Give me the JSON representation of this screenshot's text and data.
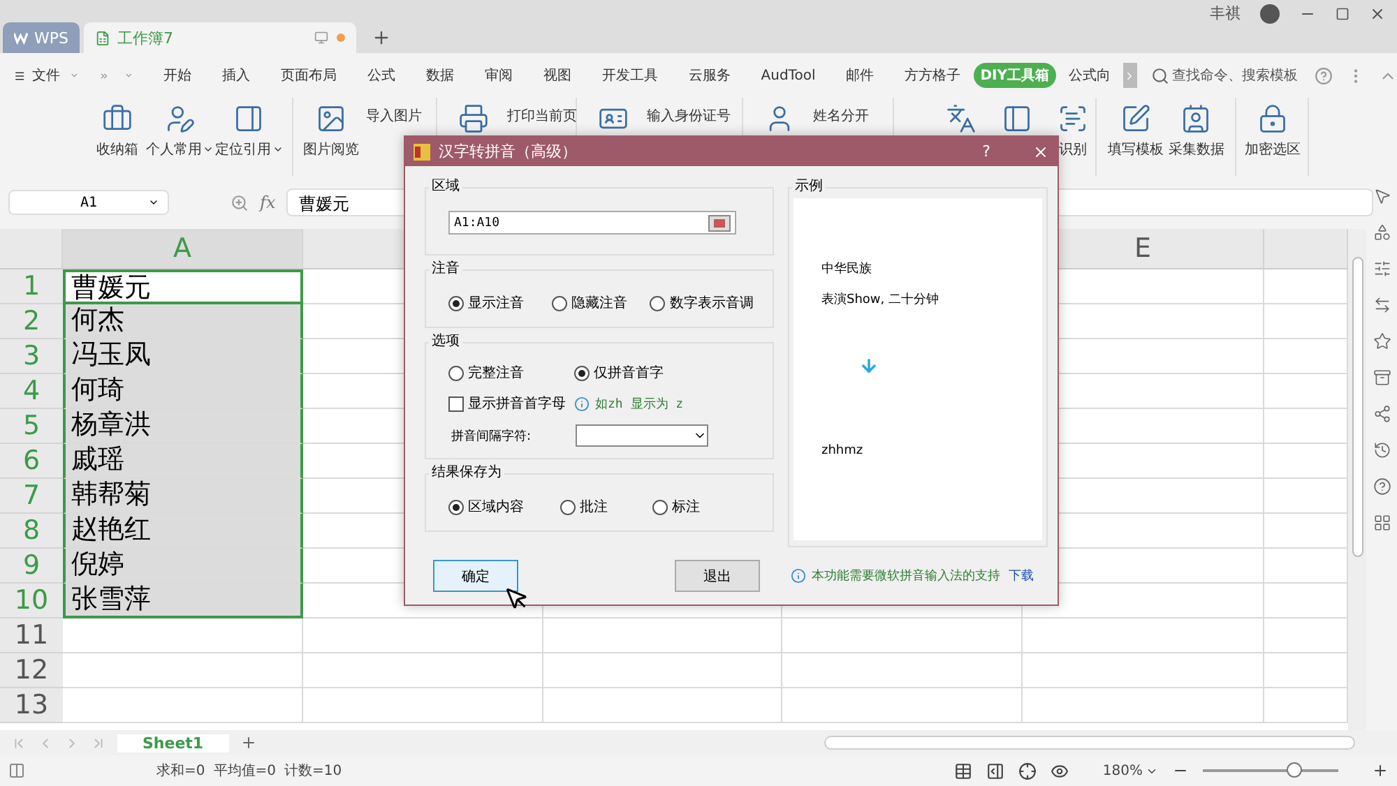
{
  "window": {
    "tabs": [
      {
        "label": "WPS",
        "selected": false
      },
      {
        "label": "工作簿7",
        "selected": true,
        "unsaved": true
      }
    ],
    "user": "丰祺"
  },
  "menu": {
    "file": "文件",
    "items": [
      {
        "label": "开始",
        "selected": false
      },
      {
        "label": "插入",
        "selected": false
      },
      {
        "label": "页面布局",
        "selected": false
      },
      {
        "label": "公式",
        "selected": false
      },
      {
        "label": "数据",
        "selected": false
      },
      {
        "label": "审阅",
        "selected": false
      },
      {
        "label": "视图",
        "selected": false
      },
      {
        "label": "开发工具",
        "selected": false
      },
      {
        "label": "云服务",
        "selected": false
      },
      {
        "label": "AudTool",
        "selected": false
      },
      {
        "label": "邮件",
        "selected": false
      },
      {
        "label": "方方格子",
        "selected": false
      },
      {
        "label": "DIY工具箱",
        "selected": true
      },
      {
        "label": "公式向",
        "selected": false
      }
    ],
    "search": {
      "placeholder": "查找命令、搜索模板"
    }
  },
  "ribbon": {
    "groups": [
      {
        "items": [
          {
            "kind": "big",
            "label": "收纳箱"
          },
          {
            "kind": "big",
            "label": "个人常用",
            "dropdown": true
          },
          {
            "kind": "big",
            "label": "定位引用",
            "dropdown": true
          }
        ]
      },
      {
        "items": [
          {
            "kind": "big",
            "label": "图片阅览"
          },
          {
            "kind": "small",
            "lines": [
              "导入图片"
            ]
          }
        ]
      },
      {
        "items": [
          {
            "kind": "big"
          },
          {
            "kind": "small",
            "lines": [
              "打印当前页"
            ]
          }
        ]
      },
      {
        "items": [
          {
            "kind": "big"
          },
          {
            "kind": "small",
            "lines": [
              "输入身份证号"
            ]
          }
        ]
      },
      {
        "items": [
          {
            "kind": "big"
          },
          {
            "kind": "small",
            "lines": [
              "姓名分开"
            ]
          }
        ]
      },
      {
        "items": [
          {
            "kind": "big"
          },
          {
            "kind": "big"
          },
          {
            "kind": "big",
            "label": "识别"
          }
        ]
      },
      {
        "items": [
          {
            "kind": "big",
            "label": "填写模板"
          },
          {
            "kind": "big",
            "label": "采集数据"
          }
        ]
      },
      {
        "items": [
          {
            "kind": "big",
            "label": "加密选区"
          }
        ]
      }
    ]
  },
  "formula_bar": {
    "cell": "A1",
    "fx": "fx",
    "value": "曹媛元"
  },
  "sheet": {
    "columns": [
      {
        "label": "A",
        "selected": true
      },
      {
        "label": "E",
        "selected": false
      }
    ],
    "rows": [
      {
        "number": "1",
        "selected": true,
        "active": true,
        "value": "曹媛元"
      },
      {
        "number": "2",
        "selected": true,
        "active": false,
        "value": "何杰"
      },
      {
        "number": "3",
        "selected": true,
        "active": false,
        "value": "冯玉凤"
      },
      {
        "number": "4",
        "selected": true,
        "active": false,
        "value": "何琦"
      },
      {
        "number": "5",
        "selected": true,
        "active": false,
        "value": "杨章洪"
      },
      {
        "number": "6",
        "selected": true,
        "active": false,
        "value": "戚瑶"
      },
      {
        "number": "7",
        "selected": true,
        "active": false,
        "value": "韩帮菊"
      },
      {
        "number": "8",
        "selected": true,
        "active": false,
        "value": "赵艳红"
      },
      {
        "number": "9",
        "selected": true,
        "active": false,
        "value": "倪婷"
      },
      {
        "number": "10",
        "selected": true,
        "active": false,
        "value": "张雪萍"
      },
      {
        "number": "11",
        "selected": false,
        "active": false
      },
      {
        "number": "12",
        "selected": false,
        "active": false
      },
      {
        "number": "13",
        "selected": false,
        "active": false
      }
    ]
  },
  "sheet_tabs": [
    {
      "label": "Sheet1",
      "selected": true
    }
  ],
  "status_bar": {
    "stats": [
      "求和=0",
      "平均值=0",
      "计数=10"
    ],
    "zoom": "180%",
    "zoom_slider": {
      "level": 0.67
    }
  },
  "dialog": {
    "title": "汉字转拼音（高级）",
    "help": "?",
    "range": {
      "label": "区域",
      "value": "A1:A10"
    },
    "annotation": {
      "label": "注音",
      "options": [
        {
          "label": "显示注音",
          "selected": true
        },
        {
          "label": "隐藏注音",
          "selected": false
        },
        {
          "label": "数字表示音调",
          "selected": false
        }
      ]
    },
    "options": {
      "label": "选项",
      "modes": [
        {
          "label": "完整注音",
          "selected": false
        },
        {
          "label": "仅拼音首字",
          "selected": true
        }
      ],
      "initials": {
        "label": "显示拼音首字母",
        "checked": false
      },
      "hint": "如zh 显示为 z",
      "separator": {
        "label": "拼音间隔字符:"
      }
    },
    "save_as": {
      "label": "结果保存为",
      "options": [
        {
          "label": "区域内容",
          "selected": true
        },
        {
          "label": "批注",
          "selected": false
        },
        {
          "label": "标注",
          "selected": false
        }
      ]
    },
    "example": {
      "label": "示例",
      "lines": [
        "中华民族",
        "表演Show, 二十分钟"
      ],
      "result": "zhhmz"
    },
    "buttons": [
      {
        "label": "确定",
        "focused": true
      },
      {
        "label": "退出",
        "focused": false
      }
    ],
    "note": "本功能需要微软拼音输入法的支持",
    "link": "下载"
  }
}
